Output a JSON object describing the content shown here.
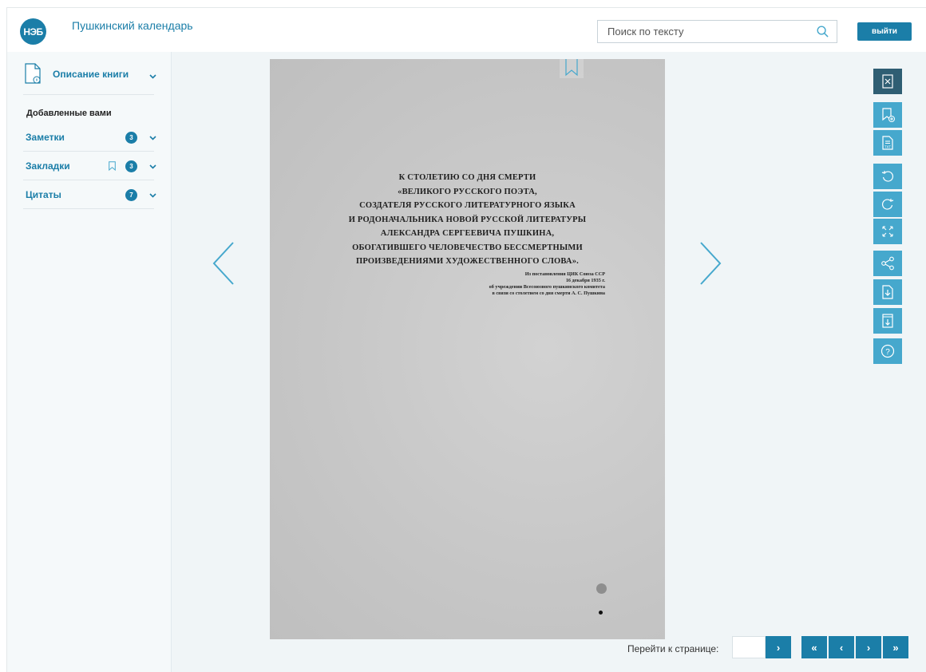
{
  "header": {
    "logo_text": "НЭБ",
    "title": "Пушкинский календарь",
    "search_placeholder": "Поиск по тексту",
    "logout_label": "выйти"
  },
  "sidebar": {
    "description_label": "Описание книги",
    "added_title": "Добавленные вами",
    "items": [
      {
        "label": "Заметки",
        "count": "3"
      },
      {
        "label": "Закладки",
        "count": "3"
      },
      {
        "label": "Цитаты",
        "count": "7"
      }
    ]
  },
  "page_content": {
    "lines": [
      "К СТОЛЕТИЮ СО ДНЯ СМЕРТИ",
      "«ВЕЛИКОГО РУССКОГО ПОЭТА,",
      "СОЗДАТЕЛЯ РУССКОГО ЛИТЕРАТУРНОГО ЯЗЫКА",
      "И РОДОНАЧАЛЬНИКА НОВОЙ РУССКОЙ ЛИТЕРАТУРЫ",
      "АЛЕКСАНДРА СЕРГЕЕВИЧА ПУШКИНА,",
      "ОБОГАТИВШЕГО ЧЕЛОВЕЧЕСТВО БЕССМЕРТНЫМИ",
      "ПРОИЗВЕДЕНИЯМИ ХУДОЖЕСТВЕННОГО СЛОВА»."
    ],
    "note_lines": [
      "Из постановления ЦИК Союза ССР",
      "16 декабря 1935 г.",
      "об учреждении Всесоюзного пушкинского комитета",
      "в связи со столетием со дня смерти А. С. Пушкина"
    ]
  },
  "toolbar": {
    "tools": [
      "close-book-icon",
      "add-bookmark-icon",
      "txt-icon",
      "rotate-left-icon",
      "rotate-right-icon",
      "fullscreen-icon",
      "share-icon",
      "download-page-icon",
      "download-book-icon",
      "help-icon"
    ]
  },
  "pagination": {
    "goto_label": "Перейти к странице:",
    "goto_value": "",
    "go_button": "›",
    "first": "«",
    "prev": "‹",
    "next": "›",
    "last": "»"
  },
  "colors": {
    "accent": "#1b7ea8",
    "tool": "#46a8cd",
    "tool_active": "#2f5e73",
    "background": "#f0f5f7"
  }
}
